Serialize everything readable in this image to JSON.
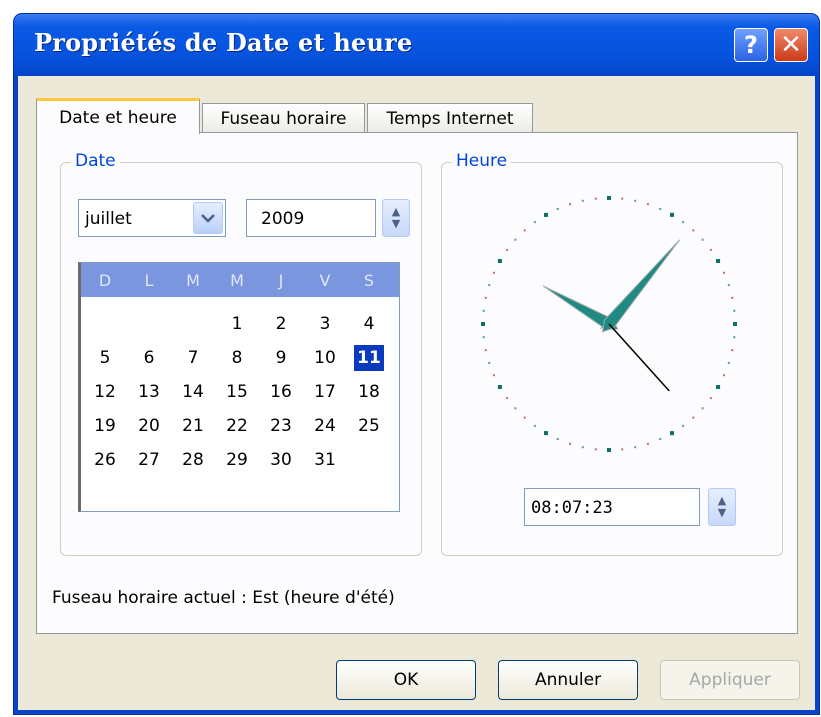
{
  "window": {
    "title": "Propriétés de Date et heure",
    "help_label": "?",
    "close_label": "✕"
  },
  "tabs": [
    {
      "label": "Date et heure",
      "active": true
    },
    {
      "label": "Fuseau horaire",
      "active": false
    },
    {
      "label": "Temps Internet",
      "active": false
    }
  ],
  "date_group": {
    "legend": "Date"
  },
  "month_select": {
    "value": "juillet",
    "icon": "chevron-down-icon"
  },
  "year_field": {
    "value": "2009"
  },
  "calendar": {
    "weekdays": [
      "D",
      "L",
      "M",
      "M",
      "J",
      "V",
      "S"
    ],
    "weeks": [
      [
        "",
        "",
        "",
        "1",
        "2",
        "3",
        "4"
      ],
      [
        "5",
        "6",
        "7",
        "8",
        "9",
        "10",
        "11"
      ],
      [
        "12",
        "13",
        "14",
        "15",
        "16",
        "17",
        "18"
      ],
      [
        "19",
        "20",
        "21",
        "22",
        "23",
        "24",
        "25"
      ],
      [
        "26",
        "27",
        "28",
        "29",
        "30",
        "31",
        ""
      ]
    ],
    "selected_day": "11"
  },
  "time_group": {
    "legend": "Heure"
  },
  "time_field": {
    "value": "08:07:23"
  },
  "status_text": "Fuseau horaire actuel : Est (heure d'été)",
  "buttons": {
    "ok": "OK",
    "cancel": "Annuler",
    "apply": "Appliquer"
  },
  "colors": {
    "title_bar": "#0a5ae6",
    "selected_day": "#0a3bbd",
    "calendar_header": "#7a96df",
    "clock_hands": "#1f8a82"
  }
}
